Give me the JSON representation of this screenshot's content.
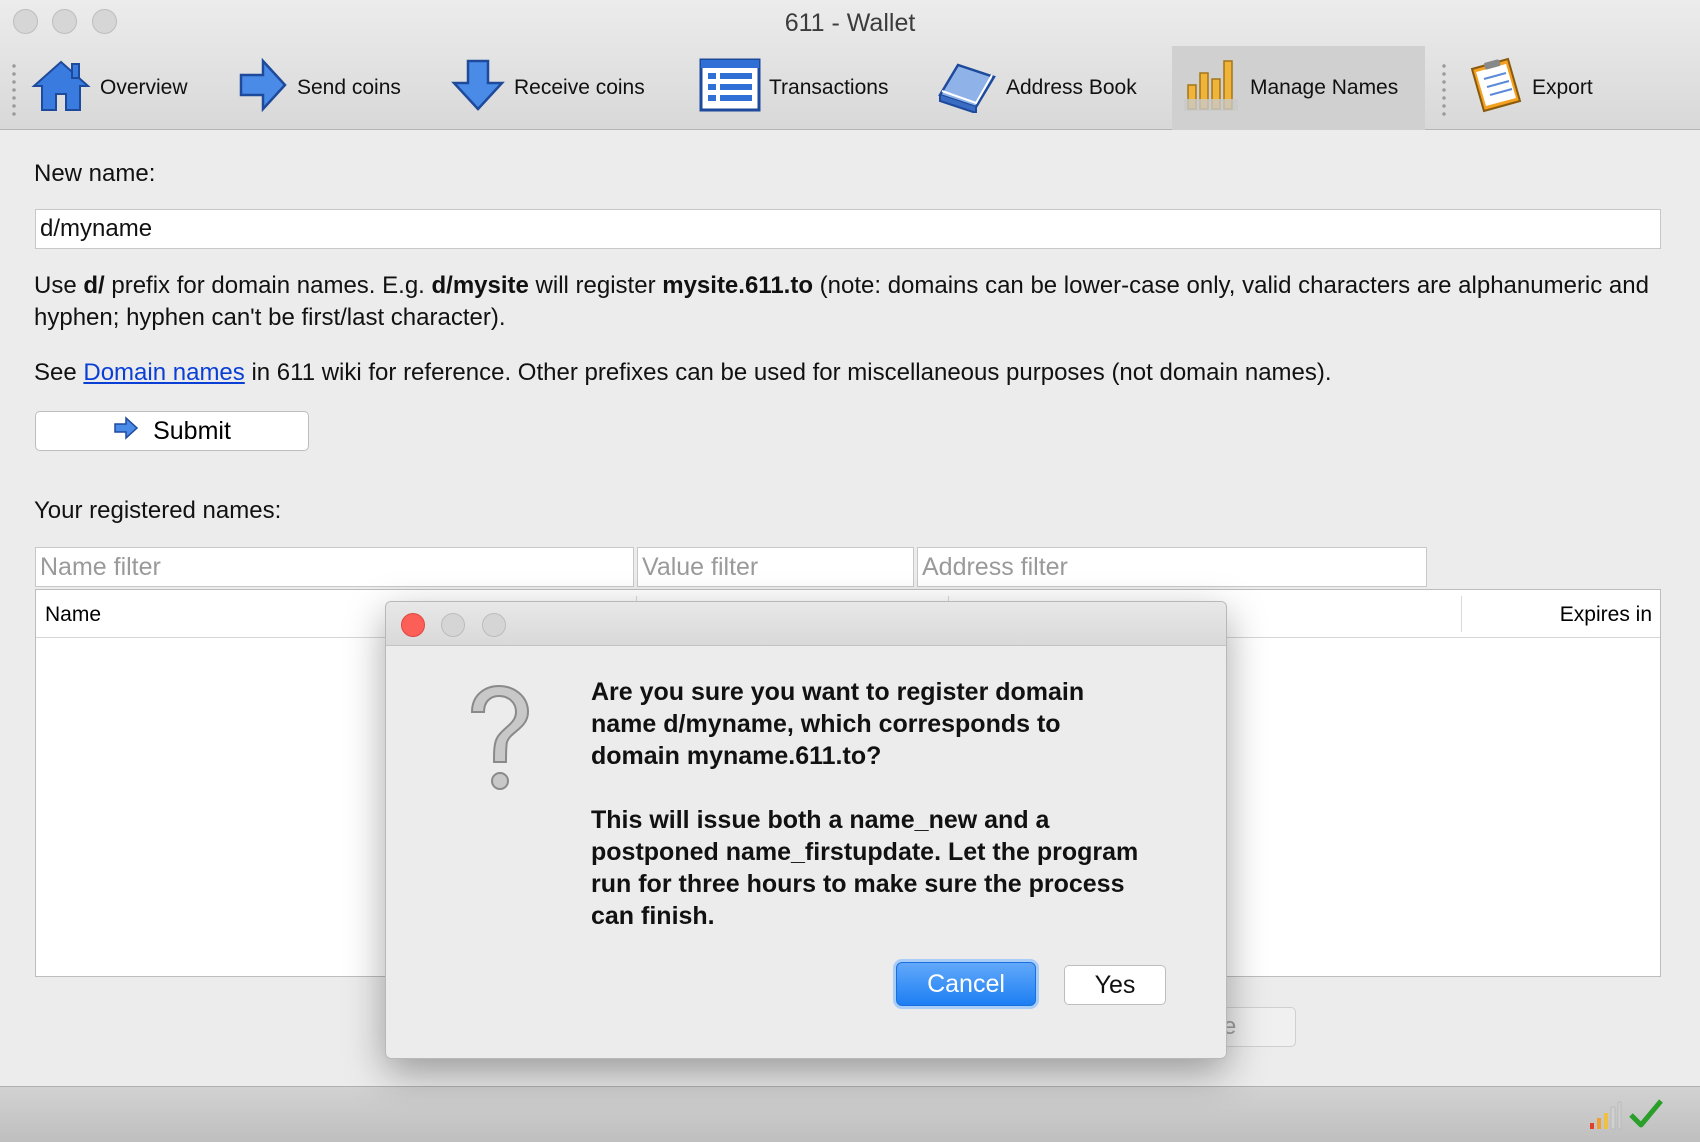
{
  "window": {
    "title": "611 - Wallet"
  },
  "toolbar": {
    "items": [
      {
        "label": "Overview",
        "icon": "home-icon"
      },
      {
        "label": "Send coins",
        "icon": "arrow-right-icon"
      },
      {
        "label": "Receive coins",
        "icon": "arrow-down-icon"
      },
      {
        "label": "Transactions",
        "icon": "list-icon"
      },
      {
        "label": "Address Book",
        "icon": "book-icon"
      },
      {
        "label": "Manage Names",
        "icon": "chart-bars-icon",
        "active": true
      },
      {
        "label": "Export",
        "icon": "clipboard-icon"
      }
    ]
  },
  "form": {
    "new_name_label": "New name:",
    "new_name_value": "d/myname",
    "help1": {
      "t1": "Use ",
      "b1": "d/",
      "t2": " prefix for domain names. E.g. ",
      "b2": "d/mysite",
      "t3": " will register ",
      "b3": "mysite.611.to",
      "t4": " (note: domains can be lower-case only, valid characters are alphanumeric and hyphen; hyphen can't be first/last character)."
    },
    "help2": {
      "t1": "See ",
      "link": "Domain names",
      "t2": " in 611 wiki for reference. Other prefixes can be used for miscellaneous purposes (not domain names)."
    },
    "submit_label": "Submit"
  },
  "registered": {
    "label": "Your registered names:",
    "filters": {
      "name_placeholder": "Name filter",
      "value_placeholder": "Value filter",
      "address_placeholder": "Address filter"
    },
    "columns": {
      "name": "Name",
      "expires": "Expires in"
    },
    "partial_button": "e"
  },
  "dialog": {
    "message1": "Are you sure you want to register domain name d/myname, which corresponds to domain myname.611.to?",
    "message2": "This will issue both a name_new and a postponed name_firstupdate. Let the program run for three hours to make sure the process can finish.",
    "cancel_label": "Cancel",
    "yes_label": "Yes",
    "icon": "question-mark-icon"
  },
  "status": {
    "sync_icon": "signal-bars-icon",
    "ok_icon": "checkmark-icon"
  },
  "colors": {
    "accent": "#1d7ff3",
    "link": "#0a3fd6",
    "close": "#fc5f57"
  }
}
